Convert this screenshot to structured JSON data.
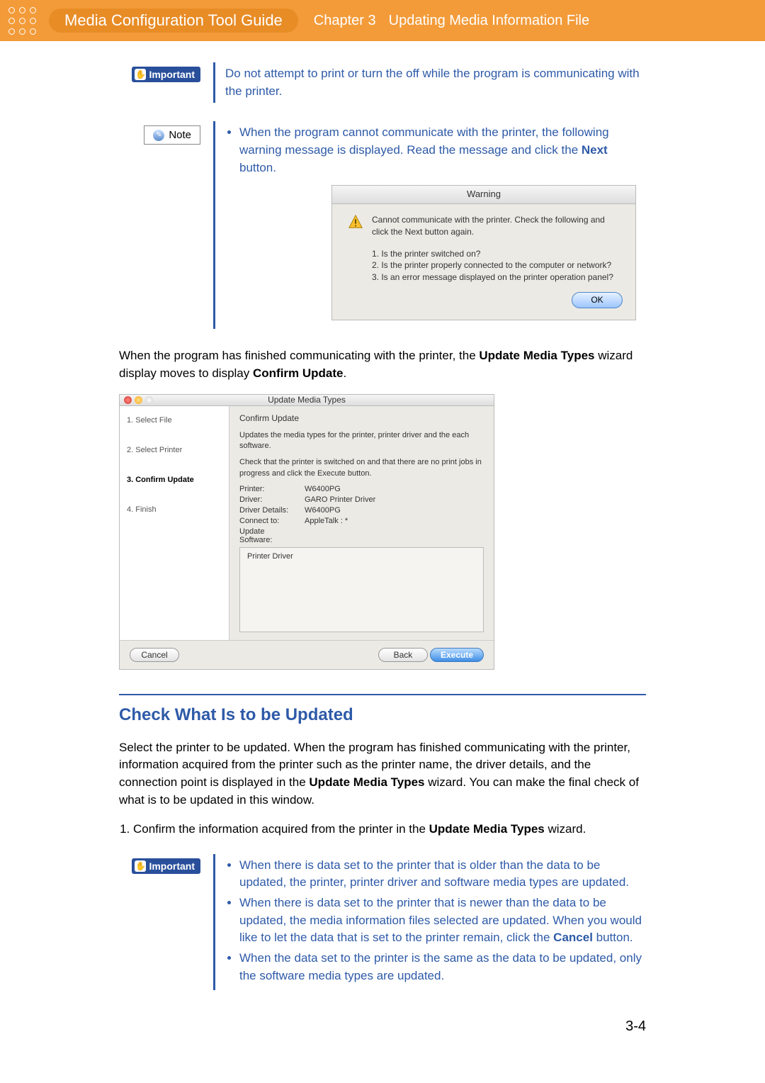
{
  "header": {
    "guide_title": "Media Configuration Tool Guide",
    "chapter_label": "Chapter 3",
    "chapter_title": "Updating Media Information File"
  },
  "important1": {
    "label": "Important",
    "text": "Do not attempt to print or turn the off while the program is communicating with the printer."
  },
  "note": {
    "label": "Note",
    "bullet_prefix": "When the program cannot communicate with the printer, the following warning message is displayed. Read the message and click the ",
    "bold": "Next",
    "suffix": " button."
  },
  "warning_dialog": {
    "title": "Warning",
    "msg1": "Cannot communicate with the printer. Check the following and click the Next button again.",
    "q1": "1. Is the printer switched on?",
    "q2": "2. Is the printer properly connected to the computer or network?",
    "q3": "3. Is an error message displayed on the printer operation panel?",
    "ok": "OK"
  },
  "para_after": {
    "pre": "When the program has finished communicating with the printer, the ",
    "b1": "Update Media Types",
    "mid": " wizard display moves to display ",
    "b2": "Confirm Update",
    "suf": "."
  },
  "wizard": {
    "title": "Update Media Types",
    "steps": [
      "1. Select File",
      "2. Select Printer",
      "3. Confirm Update",
      "4. Finish"
    ],
    "active_step_index": 2,
    "heading": "Confirm Update",
    "desc1": "Updates the media types for the printer, printer driver and the each software.",
    "desc2": "Check that the printer is switched on and that there are no print jobs in progress and click the Execute button.",
    "rows": {
      "printer_k": "Printer:",
      "printer_v": "W6400PG",
      "driver_k": "Driver:",
      "driver_v": "GARO Printer Driver",
      "details_k": "Driver Details:",
      "details_v": "W6400PG",
      "connect_k": "Connect to:",
      "connect_v": "AppleTalk : *",
      "update_k": "Update Software:"
    },
    "update_box": "Printer Driver",
    "cancel": "Cancel",
    "back": "Back",
    "execute": "Execute"
  },
  "section_heading": "Check What Is to be Updated",
  "section_para_pre": "Select the printer to be updated. When the program has finished communicating with the printer, information acquired from the printer such as the printer name, the driver details, and the connection point is displayed in the ",
  "section_para_b": "Update Media Types",
  "section_para_suf": " wizard. You can make the final check of what is to be updated in this window.",
  "step1_pre": "Confirm the information acquired from the printer in the ",
  "step1_b": "Update Media Types",
  "step1_suf": " wizard.",
  "important2": {
    "label": "Important",
    "b1": "When there is data set to the printer that is older than the data to be updated, the printer, printer driver and software media types are updated.",
    "b2_pre": "When there is data set to the printer that is newer than the data to be updated, the media information files selected are updated. When you would like to let the data that is set to the printer remain, click the ",
    "b2_b": "Cancel",
    "b2_suf": " button.",
    "b3": "When the data set to the printer is the same as the data to be updated, only the software media types are updated."
  },
  "page_number": "3-4"
}
